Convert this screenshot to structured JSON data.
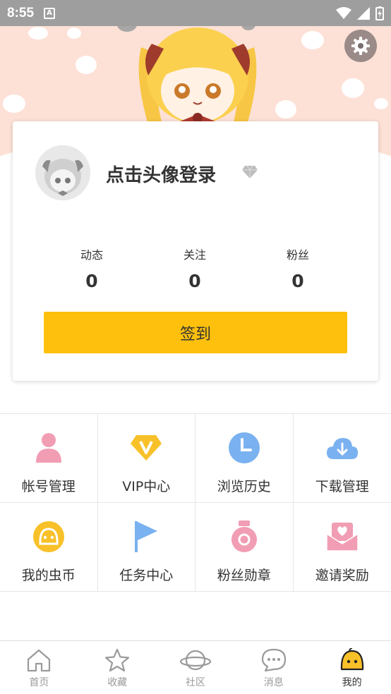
{
  "status_bar": {
    "time": "8:55",
    "notification_icon": "A"
  },
  "colors": {
    "accent": "#fec00d",
    "banner": "#fde1d6",
    "pink": "#f19db4",
    "blue": "#7ab1f0",
    "gold": "#f8c12a"
  },
  "profile": {
    "login_prompt": "点击头像登录",
    "stats": [
      {
        "label": "动态",
        "value": "0"
      },
      {
        "label": "关注",
        "value": "0"
      },
      {
        "label": "粉丝",
        "value": "0"
      }
    ],
    "signin_label": "签到"
  },
  "menu": [
    {
      "label": "帐号管理",
      "icon": "user-icon"
    },
    {
      "label": "VIP中心",
      "icon": "vip-diamond-icon"
    },
    {
      "label": "浏览历史",
      "icon": "clock-icon"
    },
    {
      "label": "下载管理",
      "icon": "cloud-download-icon"
    },
    {
      "label": "我的虫币",
      "icon": "coin-icon"
    },
    {
      "label": "任务中心",
      "icon": "flag-icon"
    },
    {
      "label": "粉丝勋章",
      "icon": "medal-icon"
    },
    {
      "label": "邀请奖励",
      "icon": "invite-envelope-icon"
    }
  ],
  "nav": [
    {
      "label": "首页",
      "icon": "home-icon"
    },
    {
      "label": "收藏",
      "icon": "star-icon"
    },
    {
      "label": "社区",
      "icon": "planet-icon"
    },
    {
      "label": "消息",
      "icon": "chat-icon"
    },
    {
      "label": "我的",
      "icon": "bug-face-icon",
      "active": true
    }
  ]
}
